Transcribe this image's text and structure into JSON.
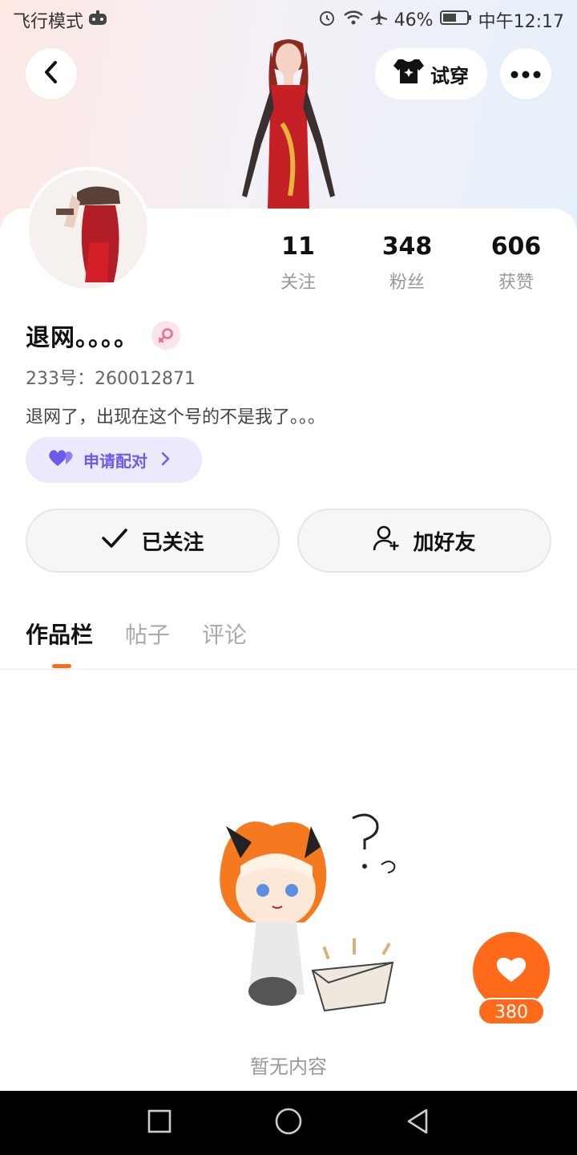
{
  "status_bar": {
    "mode": "飞行模式",
    "battery": "46%",
    "time": "中午12:17"
  },
  "header": {
    "tryon_label": "试穿"
  },
  "profile": {
    "stats": [
      {
        "value": "11",
        "label": "关注"
      },
      {
        "value": "348",
        "label": "粉丝"
      },
      {
        "value": "606",
        "label": "获赞"
      }
    ],
    "name": "退网。。。。",
    "gender": "female",
    "uid": "233号：260012871",
    "bio": "退网了，出现在这个号的不是我了。。。",
    "pair_label": "申请配对"
  },
  "actions": {
    "follow_label": "已关注",
    "add_friend_label": "加好友"
  },
  "tabs": [
    {
      "label": "作品栏",
      "active": true
    },
    {
      "label": "帖子",
      "active": false
    },
    {
      "label": "评论",
      "active": false
    }
  ],
  "empty": {
    "text": "暂无内容"
  },
  "like": {
    "count": "380"
  },
  "colors": {
    "accent": "#ff6a1a",
    "pair_purple": "#6c5ce7"
  }
}
